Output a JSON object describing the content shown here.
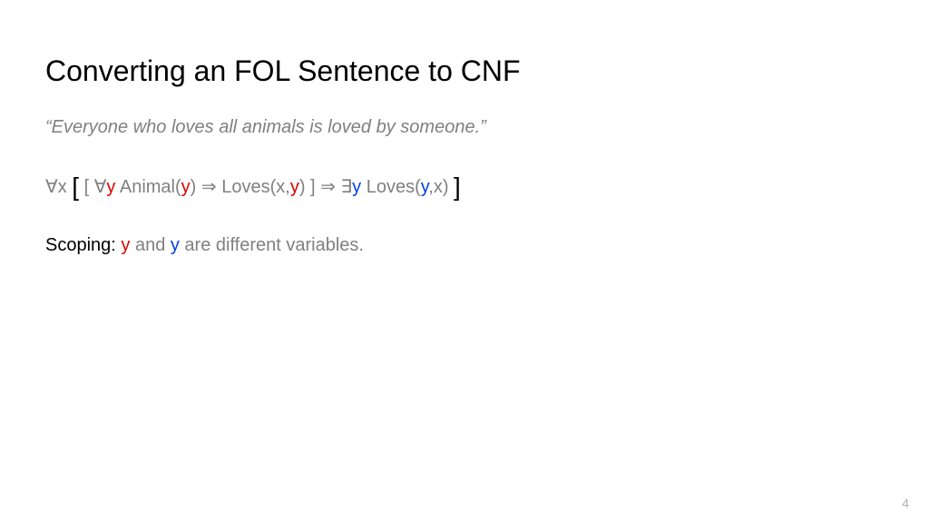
{
  "title": "Converting an FOL Sentence to CNF",
  "quote": "“Everyone who loves all animals is loved by someone.”",
  "formula": {
    "forall": "∀",
    "exists": "∃",
    "implies": "⇒",
    "x": "x",
    "y": "y",
    "big_open": "[",
    "big_close": "]",
    "open": "[",
    "close": "]",
    "animal_open": " Animal(",
    "animal_close": ")",
    "loves_open": " Loves(",
    "comma": ",",
    "close_paren": ")"
  },
  "scoping": {
    "label": "Scoping: ",
    "y_red": "y",
    "and": " and ",
    "y_blue": "y",
    "rest": " are different variables."
  },
  "page_number": "4"
}
